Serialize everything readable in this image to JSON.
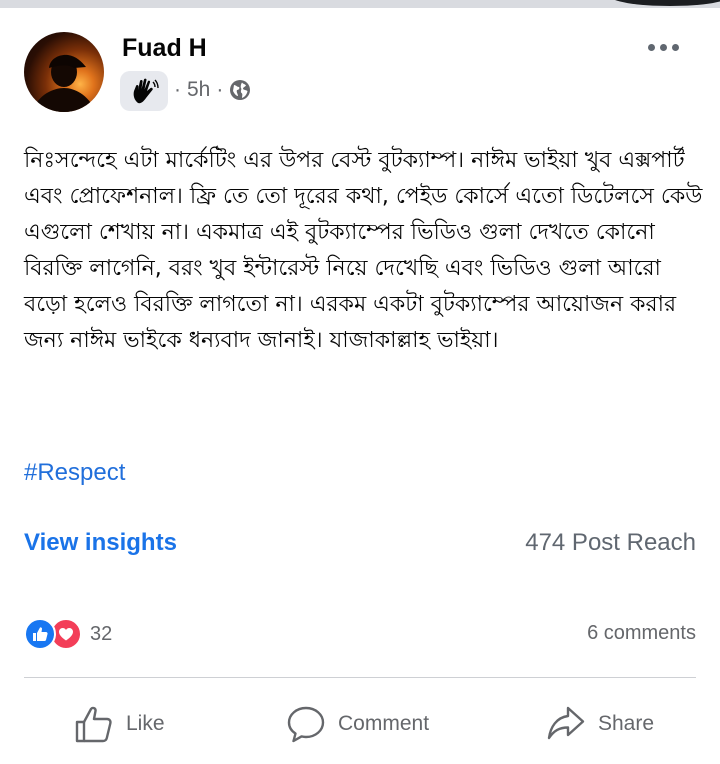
{
  "post": {
    "author": "Fuad H",
    "time": "5h",
    "separator": "·",
    "privacy_icon": "globe-icon",
    "badge_icon": "waving-hand-icon",
    "text": "নিঃসন্দেহে এটা মার্কেটিং এর উপর বেস্ট বুটক্যাম্প। নাঈম ভাইয়া খুব এক্সপার্ট এবং প্রোফেশনাল। ফ্রি তে তো দূরের কথা, পেইড কোর্সে এতো ডিটেলসে কেউ এগুলো শেখায় না। একমাত্র এই বুটক্যাম্পের ভিডিও গুলা দেখতে কোনো বিরক্তি লাগেনি, বরং খুব ইন্টারেস্ট নিয়ে দেখেছি এবং ভিডিও গুলা আরো বড়ো হলেও বিরক্তি লাগতো না। এরকম একটা বুটক্যাম্পের আয়োজন করার জন্য নাঈম ভাইকে ধন্যবাদ জানাই। যাজাকাল্লাহ ভাইয়া।",
    "hashtag": "#Respect"
  },
  "insights": {
    "link": "View insights",
    "reach": "474 Post Reach"
  },
  "engagement": {
    "reaction_icons": [
      "like-icon",
      "love-icon"
    ],
    "reaction_count": "32",
    "comments": "6 comments"
  },
  "actions": {
    "like": "Like",
    "comment": "Comment",
    "share": "Share"
  },
  "colors": {
    "link_blue": "#1a73e8",
    "hashtag_blue": "#216fdb",
    "like_blue": "#1877f2",
    "love_red": "#f33e58",
    "muted_text": "#65676b"
  }
}
